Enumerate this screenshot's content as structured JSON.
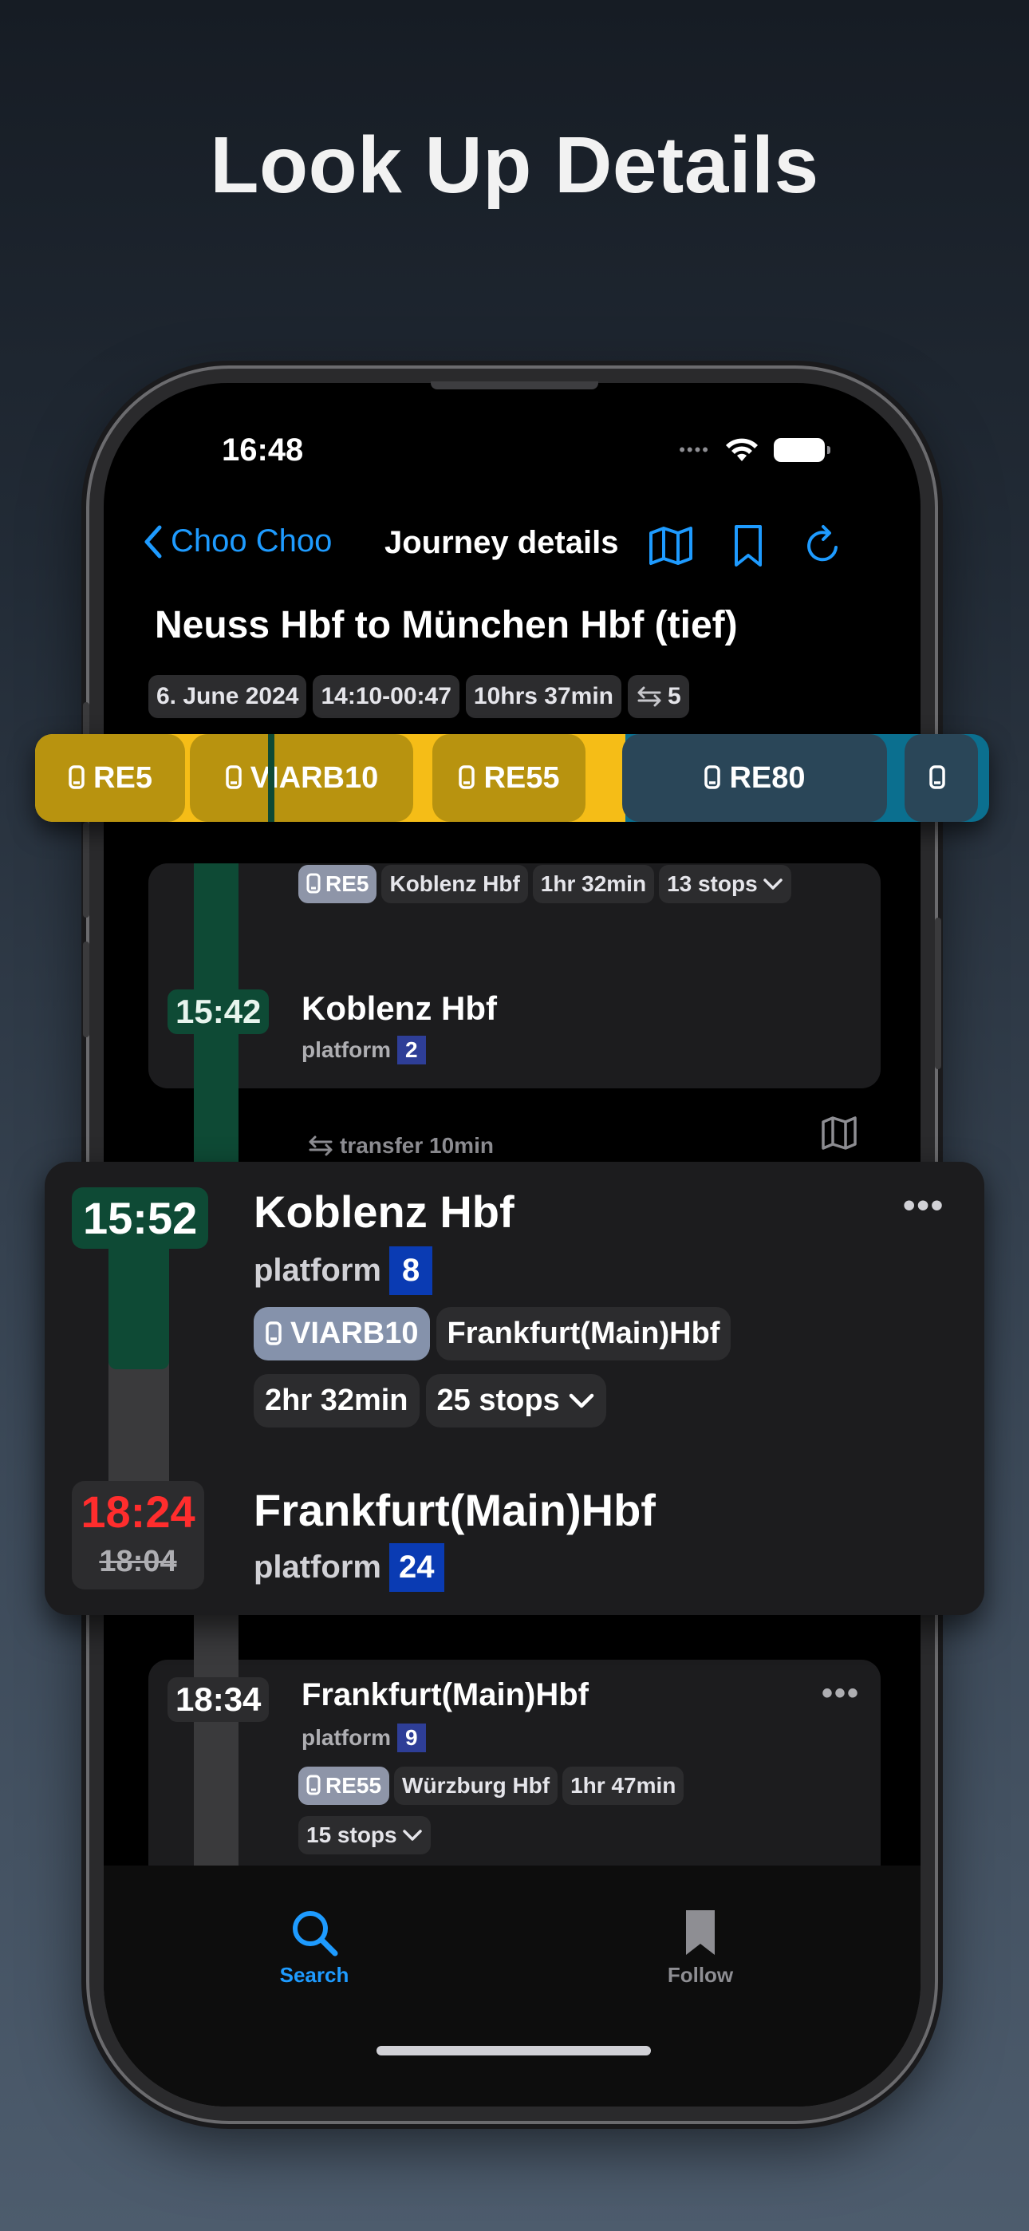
{
  "headline": "Look Up Details",
  "status_bar": {
    "time": "16:48"
  },
  "nav": {
    "back_label": "Choo Choo",
    "title": "Journey details"
  },
  "journey": {
    "title": "Neuss Hbf to München Hbf (tief)",
    "date": "6. June 2024",
    "time_range": "14:10-00:47",
    "duration": "10hrs 37min",
    "transfers": "5"
  },
  "train_strip": [
    "RE5",
    "VIARB10",
    "RE55",
    "RE80",
    ""
  ],
  "card1": {
    "train": "RE5",
    "destination": "Koblenz Hbf",
    "duration": "1hr 32min",
    "stops": "13 stops",
    "arrival_time": "15:42",
    "station": "Koblenz Hbf",
    "platform_label": "platform",
    "platform": "2"
  },
  "transfer": {
    "label": "transfer 10min"
  },
  "detail": {
    "dep_time": "15:52",
    "dep_station": "Koblenz Hbf",
    "dep_platform_label": "platform",
    "dep_platform": "8",
    "train": "VIARB10",
    "destination": "Frankfurt(Main)Hbf",
    "duration": "2hr 32min",
    "stops": "25 stops",
    "arr_time": "18:24",
    "arr_scheduled": "18:04",
    "arr_station": "Frankfurt(Main)Hbf",
    "arr_platform_label": "platform",
    "arr_platform": "24"
  },
  "card3": {
    "time": "18:34",
    "station": "Frankfurt(Main)Hbf",
    "platform_label": "platform",
    "platform": "9",
    "train": "RE55",
    "destination": "Würzburg Hbf",
    "duration": "1hr 47min",
    "stops": "15 stops"
  },
  "tabs": {
    "search": "Search",
    "follow": "Follow"
  },
  "colors": {
    "accent": "#1e9bff",
    "delay": "#ff2d2d",
    "green_line": "#0e4a35",
    "yellow_line": "#f5bd17",
    "blue_line": "#0b6f8f"
  }
}
